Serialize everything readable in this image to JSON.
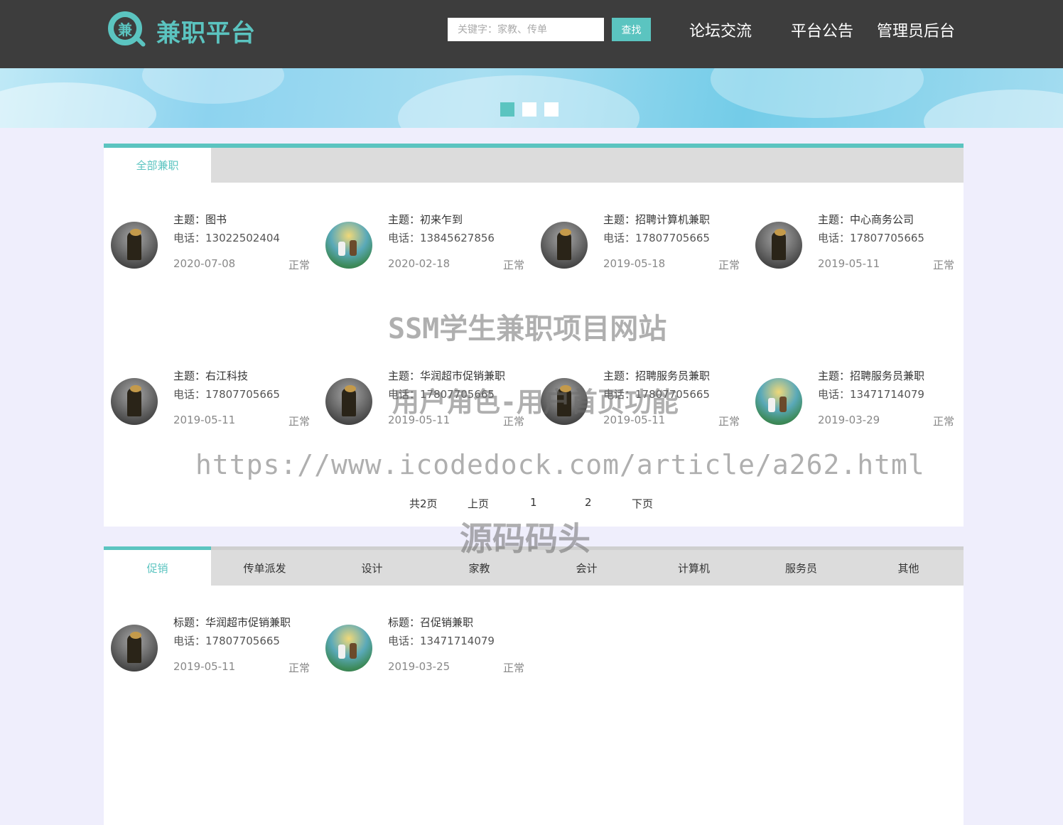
{
  "header": {
    "logo_char": "兼",
    "logo_text": "兼职平台",
    "search_placeholder": "关键字：家教、传单",
    "search_button": "查找",
    "nav": [
      "论坛交流",
      "平台公告",
      "管理员后台"
    ]
  },
  "colors": {
    "accent": "#5bc4c0",
    "header_bg": "#3d3d3d",
    "page_bg": "#efeefc",
    "tab_bar": "#dcdcdc"
  },
  "section_all": {
    "tab": "全部兼职",
    "items": [
      {
        "topic": "主题：图书",
        "phone": "电话：13022502404",
        "date": "2020-07-08",
        "status": "正常",
        "avatar": "warrior"
      },
      {
        "topic": "主题：初来乍到",
        "phone": "电话：13845627856",
        "date": "2020-02-18",
        "status": "正常",
        "avatar": "garden"
      },
      {
        "topic": "主题：招聘计算机兼职",
        "phone": "电话：17807705665",
        "date": "2019-05-18",
        "status": "正常",
        "avatar": "warrior"
      },
      {
        "topic": "主题：中心商务公司",
        "phone": "电话：17807705665",
        "date": "2019-05-11",
        "status": "正常",
        "avatar": "warrior"
      },
      {
        "topic": "主题：右江科技",
        "phone": "电话：17807705665",
        "date": "2019-05-11",
        "status": "正常",
        "avatar": "warrior"
      },
      {
        "topic": "主题：华润超市促销兼职",
        "phone": "电话：17807705665",
        "date": "2019-05-11",
        "status": "正常",
        "avatar": "warrior"
      },
      {
        "topic": "主题：招聘服务员兼职",
        "phone": "电话：17807705665",
        "date": "2019-05-11",
        "status": "正常",
        "avatar": "warrior"
      },
      {
        "topic": "主题：招聘服务员兼职",
        "phone": "电话：13471714079",
        "date": "2019-03-29",
        "status": "正常",
        "avatar": "garden"
      }
    ],
    "pager": {
      "total": "共2页",
      "prev": "上页",
      "page1": "1",
      "page2": "2",
      "next": "下页"
    }
  },
  "section_category": {
    "tabs": [
      "促销",
      "传单派发",
      "设计",
      "家教",
      "会计",
      "计算机",
      "服务员",
      "其他"
    ],
    "items": [
      {
        "title": "标题：华润超市促销兼职",
        "phone": "电话：17807705665",
        "date": "2019-05-11",
        "status": "正常",
        "avatar": "warrior"
      },
      {
        "title": "标题：召促销兼职",
        "phone": "电话：13471714079",
        "date": "2019-03-25",
        "status": "正常",
        "avatar": "garden"
      }
    ]
  },
  "watermarks": [
    "SSM学生兼职项目网站",
    "用户角色-用户首页功能",
    "https://www.icodedock.com/article/a262.html",
    "源码码头"
  ]
}
